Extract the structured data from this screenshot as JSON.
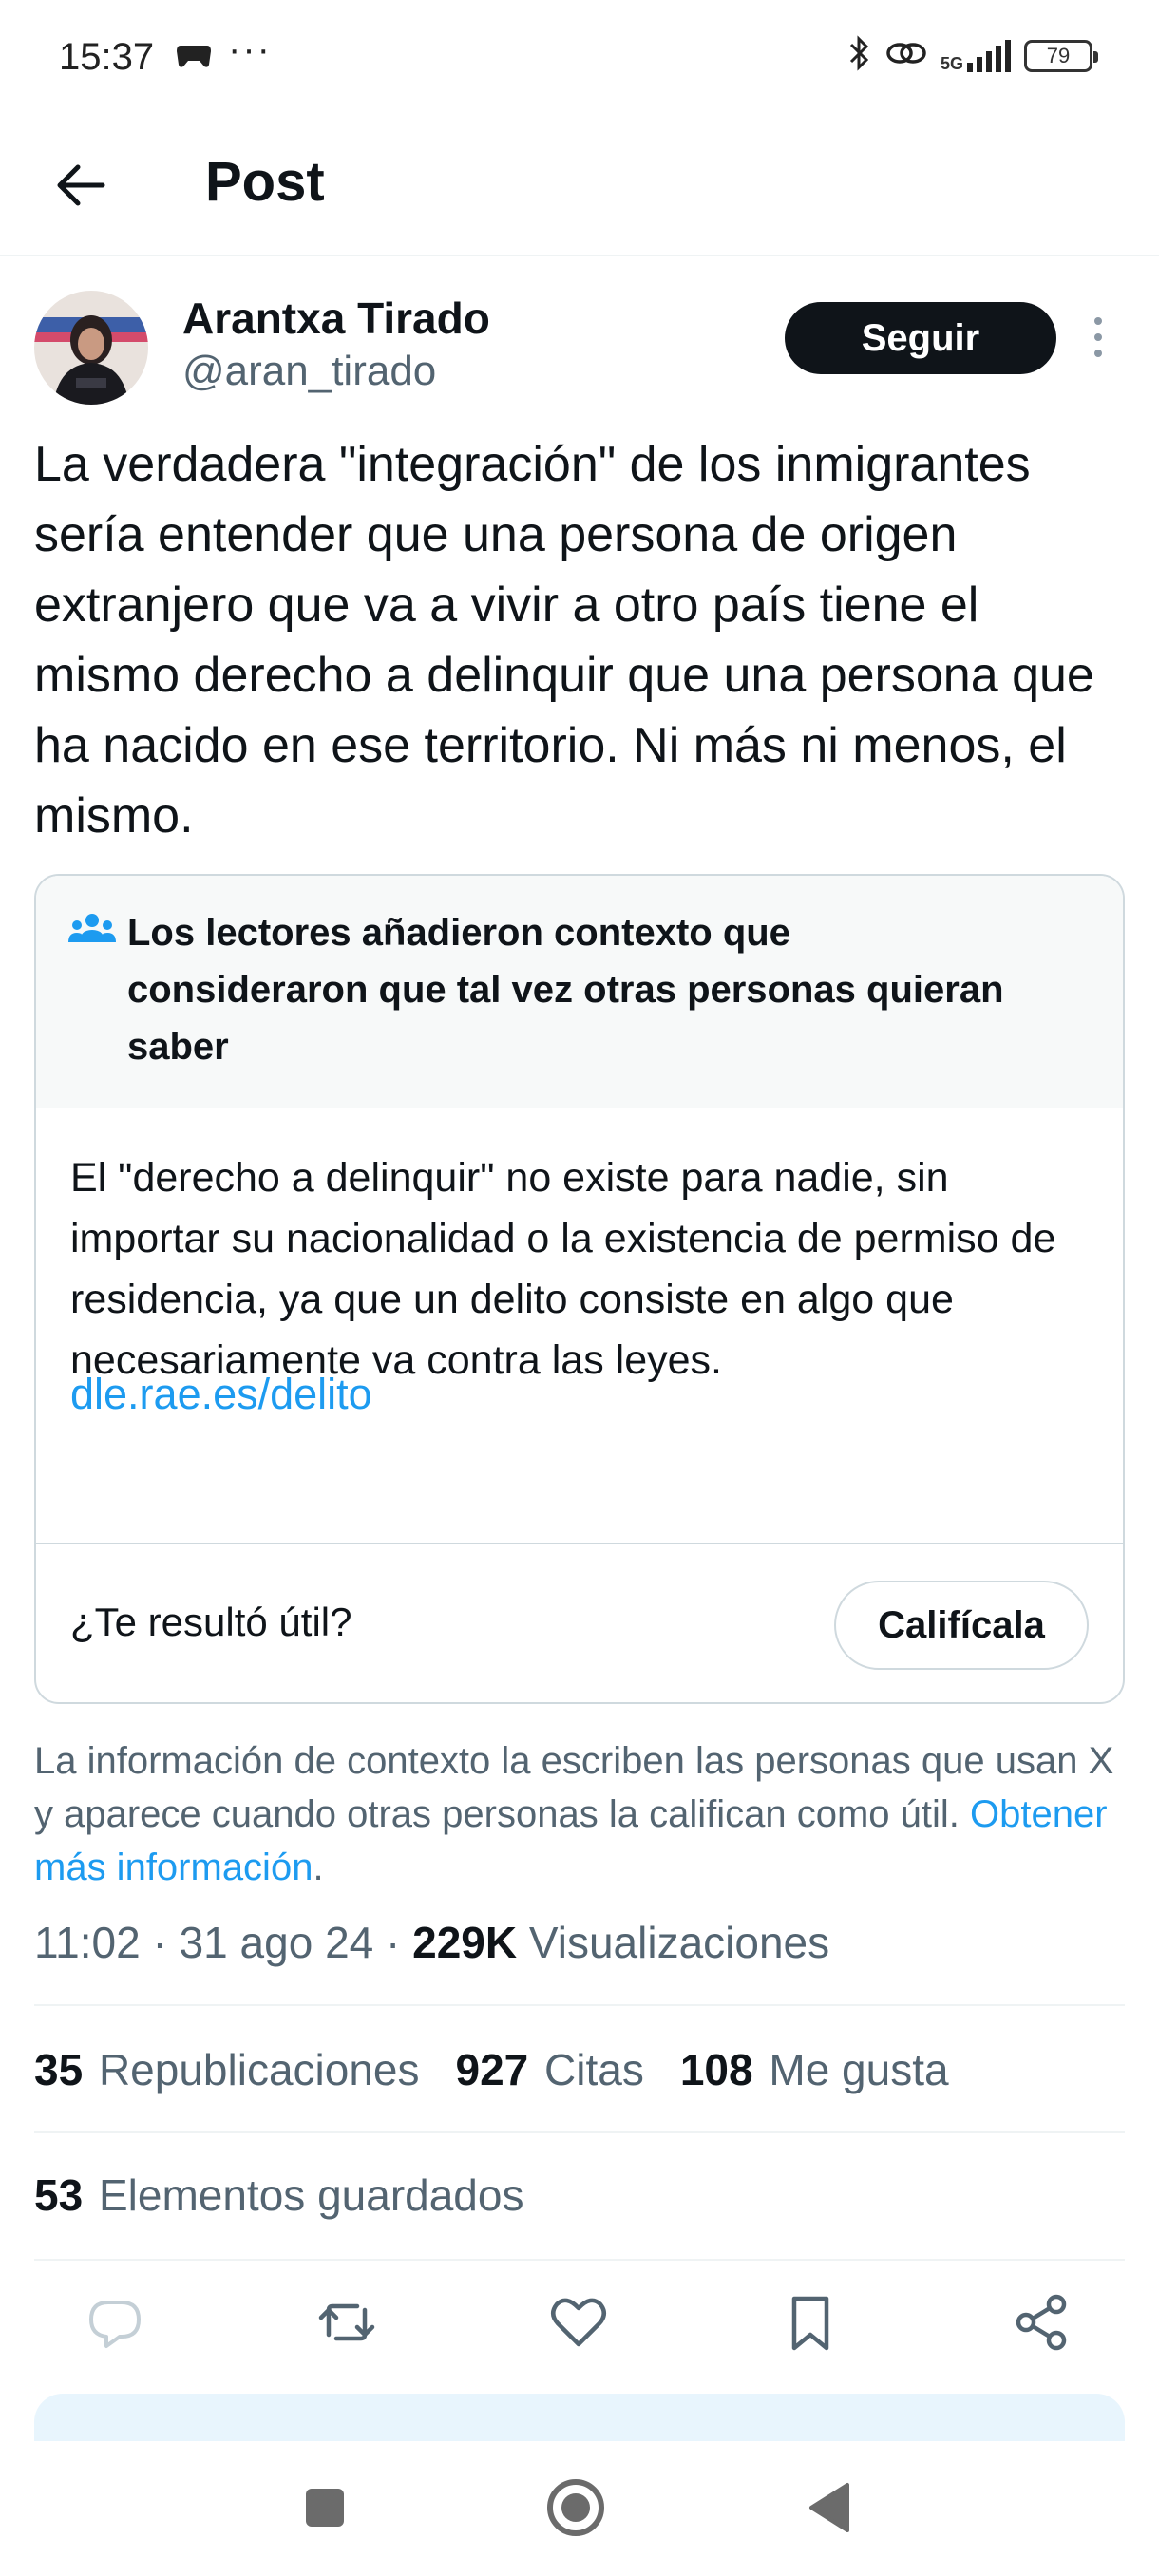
{
  "status_bar": {
    "time": "15:37",
    "dots": "···",
    "network": "5G",
    "battery": "79",
    "icons": [
      "game-controller-icon",
      "bluetooth-icon",
      "link-icon",
      "signal-icon",
      "battery-icon"
    ]
  },
  "header": {
    "title": "Post",
    "back_icon": "arrow-left-icon"
  },
  "author": {
    "name": "Arantxa Tirado",
    "handle": "@aran_tirado",
    "follow_label": "Seguir"
  },
  "post": {
    "text": "La verdadera \"integración\" de los inmigrantes sería entender que una persona de origen extranjero que va a vivir a otro país tiene el mismo derecho a delinquir que una persona que ha nacido en ese territorio. Ni más ni menos, el mismo."
  },
  "note": {
    "title": "Los lectores añadieron contexto que consideraron que tal vez otras personas quieran saber",
    "body": "El \"derecho a delinquir\" no existe para nadie, sin importar su nacionalidad o la existencia de permiso de residencia, ya que un delito consiste en algo que necesariamente va contra las leyes.",
    "link": "dle.rae.es/delito",
    "question": "¿Te resultó útil?",
    "rate_label": "Califícala"
  },
  "context_info": {
    "text": "La información de contexto la escriben las personas que usan X y aparece cuando otras personas la califican como útil.",
    "link": "Obtener más información",
    "period": "."
  },
  "meta": {
    "time": "11:02",
    "sep1": " · ",
    "date": "31 ago 24",
    "sep2": " · ",
    "views_count": "229K",
    "views_label": "Visualizaciones"
  },
  "stats": {
    "reposts_count": "35",
    "reposts_label": "Republicaciones",
    "quotes_count": "927",
    "quotes_label": "Citas",
    "likes_count": "108",
    "likes_label": "Me gusta",
    "saved_count": "53",
    "saved_label": "Elementos guardados"
  },
  "colors": {
    "accent": "#1d9bf0",
    "text": "#0f1419",
    "muted": "#536471",
    "border": "#cfd9de"
  }
}
